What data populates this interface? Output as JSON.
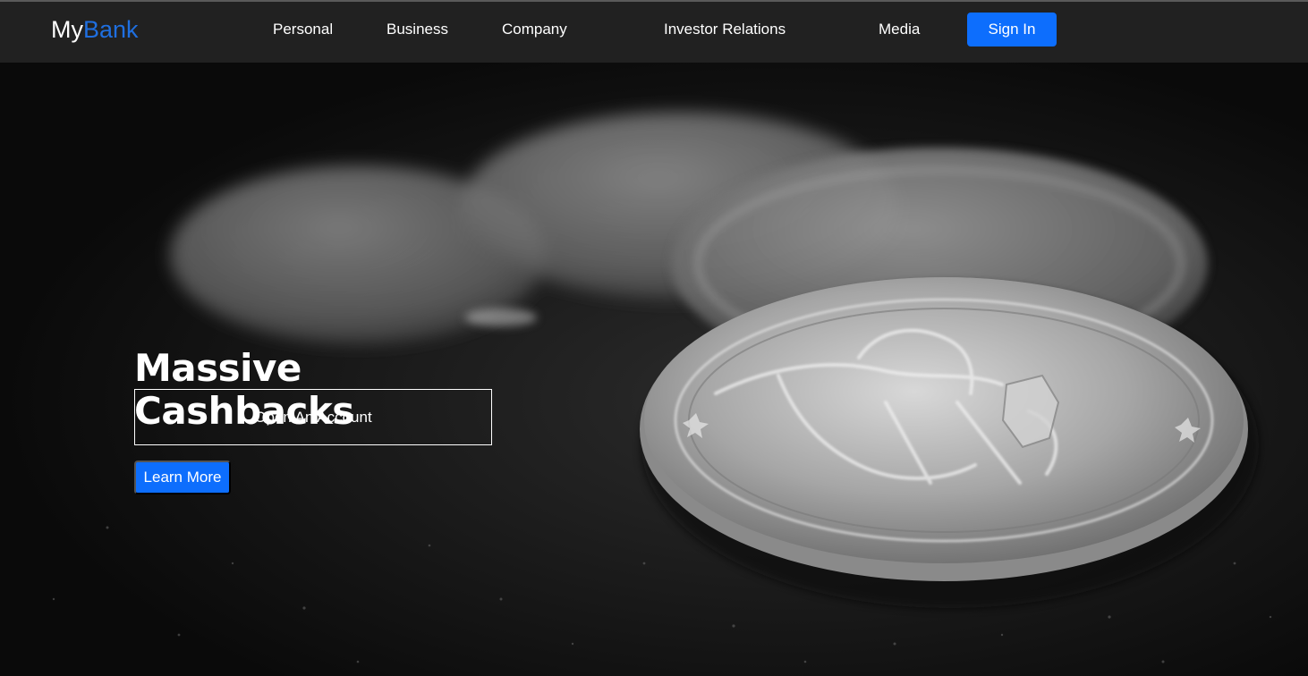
{
  "brand": {
    "logo_prefix": "My",
    "logo_accent": "Bank",
    "accent_color": "#1f6fe0"
  },
  "nav": {
    "items": [
      {
        "label": "Personal"
      },
      {
        "label": "Business"
      },
      {
        "label": "Company"
      },
      {
        "label": "Investor Relations"
      },
      {
        "label": "Media"
      }
    ],
    "sign_in_label": "Sign In",
    "primary_button_color": "#0d6efd"
  },
  "hero": {
    "headline_line1": "Massive",
    "headline_line2": "Cashbacks",
    "open_account_label": "Open An Account",
    "learn_more_label": "Learn More",
    "background_image": "coin-photo"
  }
}
